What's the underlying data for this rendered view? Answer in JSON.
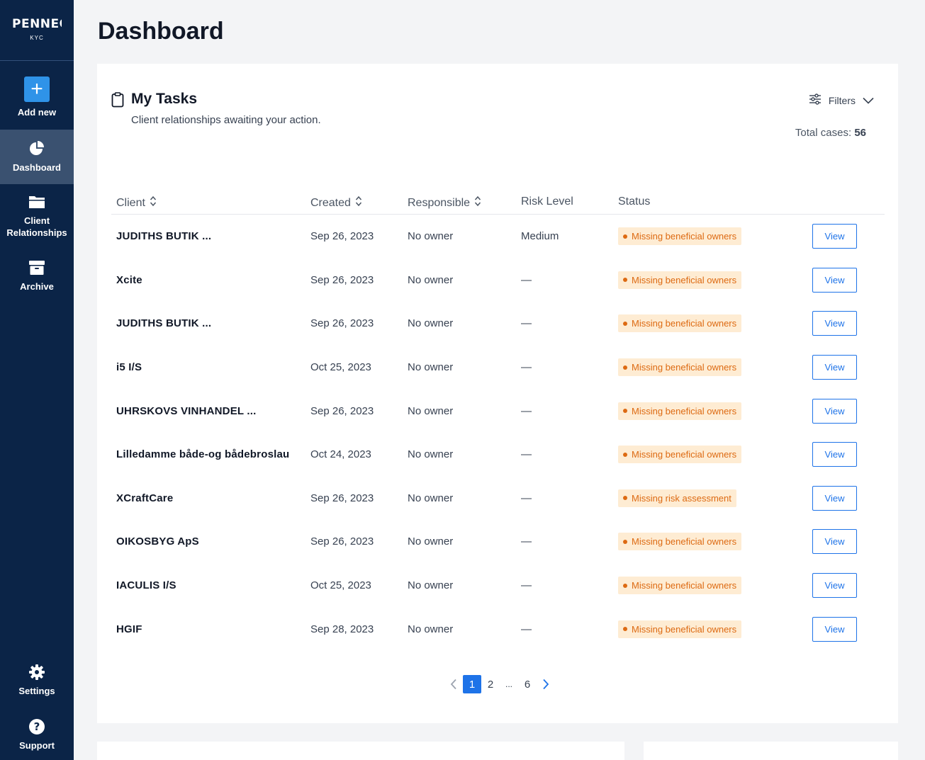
{
  "brand": {
    "name": "PENNEO",
    "product": "KYC"
  },
  "sidebar": {
    "add_new": "Add new",
    "items": [
      {
        "label": "Dashboard",
        "icon": "pie-chart-icon"
      },
      {
        "label": "Client Relationships",
        "icon": "folder-icon"
      },
      {
        "label": "Archive",
        "icon": "archive-box-icon"
      }
    ],
    "settings": "Settings",
    "support": "Support"
  },
  "page_title": "Dashboard",
  "tasks": {
    "title": "My Tasks",
    "subtitle": "Client relationships awaiting your action.",
    "filters_label": "Filters",
    "total_label": "Total cases:",
    "total_value": "56",
    "columns": {
      "client": "Client",
      "created": "Created",
      "responsible": "Responsible",
      "risk": "Risk Level",
      "status": "Status"
    },
    "view_label": "View",
    "rows": [
      {
        "client": "JUDITHS BUTIK ...",
        "created": "Sep 26, 2023",
        "responsible": "No owner",
        "risk": "Medium",
        "status": "Missing beneficial owners"
      },
      {
        "client": "Xcite",
        "created": "Sep 26, 2023",
        "responsible": "No owner",
        "risk": "—",
        "status": "Missing beneficial owners"
      },
      {
        "client": "JUDITHS BUTIK ...",
        "created": "Sep 26, 2023",
        "responsible": "No owner",
        "risk": "—",
        "status": "Missing beneficial owners"
      },
      {
        "client": "i5 I/S",
        "created": "Oct 25, 2023",
        "responsible": "No owner",
        "risk": "—",
        "status": "Missing beneficial owners"
      },
      {
        "client": "UHRSKOVS VINHANDEL ...",
        "created": "Sep 26, 2023",
        "responsible": "No owner",
        "risk": "—",
        "status": "Missing beneficial owners"
      },
      {
        "client": "Lilledamme både-og bådebroslau",
        "created": "Oct 24, 2023",
        "responsible": "No owner",
        "risk": "—",
        "status": "Missing beneficial owners"
      },
      {
        "client": "XCraftCare",
        "created": "Sep 26, 2023",
        "responsible": "No owner",
        "risk": "—",
        "status": "Missing risk assessment"
      },
      {
        "client": "OIKOSBYG ApS",
        "created": "Sep 26, 2023",
        "responsible": "No owner",
        "risk": "—",
        "status": "Missing beneficial owners"
      },
      {
        "client": "IACULIS I/S",
        "created": "Oct 25, 2023",
        "responsible": "No owner",
        "risk": "—",
        "status": "Missing beneficial owners"
      },
      {
        "client": "HGIF",
        "created": "Sep 28, 2023",
        "responsible": "No owner",
        "risk": "—",
        "status": "Missing beneficial owners"
      }
    ],
    "pagination": {
      "pages": [
        "1",
        "2",
        "...",
        "6"
      ],
      "current": "1"
    }
  },
  "colors": {
    "sidebar": "#0b2447",
    "accent": "#1e73e8",
    "badge_bg": "#feecd3",
    "badge_text": "#dd6a12"
  }
}
